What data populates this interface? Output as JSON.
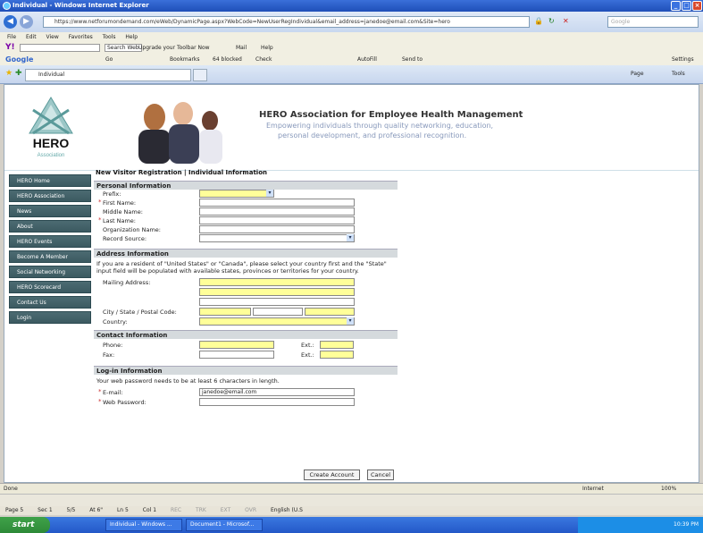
{
  "window": {
    "title": "Individual - Windows Internet Explorer"
  },
  "address_bar": {
    "url": "https://www.netforumondemand.com/eWeb/DynamicPage.aspx?WebCode=NewUserRegIndividual&email_address=janedoe@email.com&Site=hero",
    "search_placeholder": "Google"
  },
  "menu": [
    "File",
    "Edit",
    "View",
    "Favorites",
    "Tools",
    "Help"
  ],
  "yahoo_toolbar": {
    "search_button": "Search Web",
    "upgrade": "Upgrade your Toolbar Now",
    "mail": "Mail",
    "help": "Help"
  },
  "google_toolbar": {
    "go": "Go",
    "bookmarks": "Bookmarks",
    "blocked": "64 blocked",
    "check": "Check",
    "autofill": "AutoFill",
    "sendto": "Send to",
    "settings": "Settings"
  },
  "tab": {
    "label": "Individual",
    "tools": [
      "Page",
      "Tools"
    ]
  },
  "header": {
    "logo_text": "HERO",
    "logo_subtext": "Association",
    "title": "HERO Association for Employee Health Management",
    "tagline1": "Empowering individuals through quality networking, education,",
    "tagline2": "personal development, and professional recognition."
  },
  "sidebar": [
    "HERO Home",
    "HERO Association",
    "News",
    "About",
    "HERO Events",
    "Become A Member",
    "Social Networking",
    "HERO Scorecard",
    "Contact Us",
    "Login"
  ],
  "form": {
    "breadcrumb": "New Visitor Registration | Individual Information",
    "personal": {
      "heading": "Personal Information",
      "prefix": "Prefix:",
      "first": "First Name:",
      "middle": "Middle Name:",
      "last": "Last Name:",
      "org": "Organization Name:",
      "source": "Record Source:"
    },
    "address": {
      "heading": "Address Information",
      "note": "If you are a resident of \"United States\" or \"Canada\", please select your country first and the \"State\" input field will be populated with available states, provinces or territories for your country.",
      "mailing": "Mailing Address:",
      "city": "City / State / Postal Code:",
      "country": "Country:"
    },
    "contact": {
      "heading": "Contact Information",
      "phone": "Phone:",
      "fax": "Fax:",
      "ext": "Ext.:"
    },
    "login": {
      "heading": "Log-in Information",
      "note": "Your web password needs to be at least 6 characters in length.",
      "email_label": "E-mail:",
      "email_value": "janedoe@email.com",
      "password_label": "Web Password:"
    },
    "create_button": "Create Account",
    "cancel_button": "Cancel"
  },
  "status_bar": {
    "left": "Done",
    "zone": "Internet",
    "zoom": "100%"
  },
  "word_status": [
    "Page 5",
    "Sec 1",
    "5/5",
    "At 6\"",
    "Ln 5",
    "Col 1",
    "REC",
    "TRK",
    "EXT",
    "OVR",
    "English (U.S"
  ],
  "taskbar": {
    "start": "start",
    "tasks": [
      "Individual - Windows ...",
      "Document1 - Microsof..."
    ],
    "clock": "10:39 PM"
  }
}
